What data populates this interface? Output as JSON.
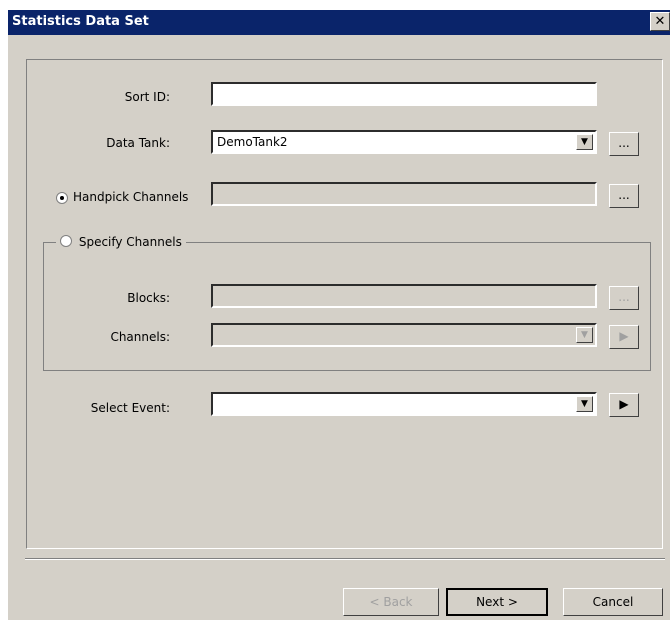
{
  "window": {
    "title": "Statistics Data Set",
    "close_glyph": "✕"
  },
  "sort_id": {
    "label": "Sort ID:",
    "value": ""
  },
  "data_tank": {
    "label": "Data Tank:",
    "value": "DemoTank2",
    "browse_label": "..."
  },
  "handpick": {
    "label": "Handpick Channels",
    "value": "",
    "browse_label": "...",
    "selected": true
  },
  "specify": {
    "label": "Specify Channels",
    "selected": false
  },
  "blocks": {
    "label": "Blocks:",
    "value": "",
    "browse_label": "..."
  },
  "channels": {
    "label": "Channels:",
    "value": ""
  },
  "select_event": {
    "label": "Select Event:",
    "value": ""
  },
  "buttons": {
    "back": "< Back",
    "next": "Next >",
    "cancel": "Cancel"
  }
}
